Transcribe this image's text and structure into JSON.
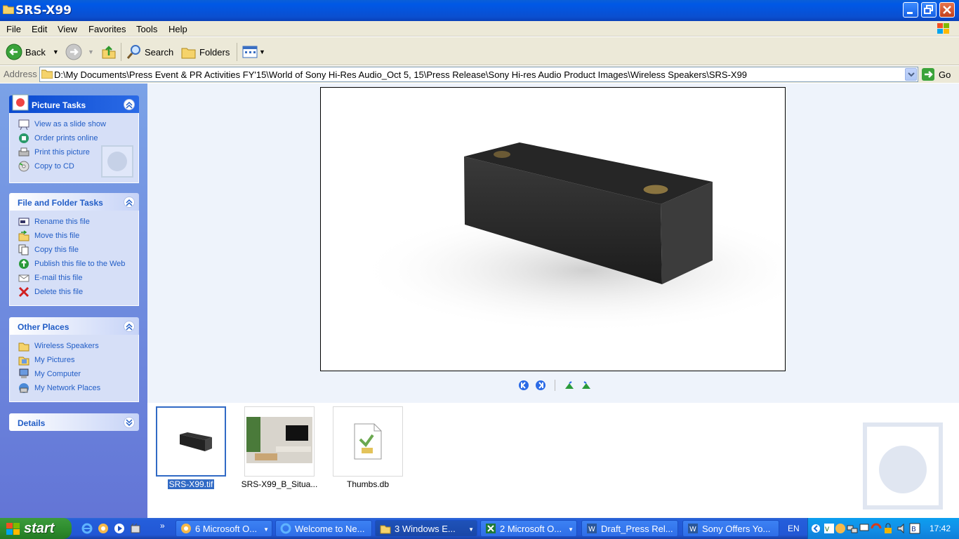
{
  "window": {
    "title": "SRS-X99",
    "controls": [
      "minimize",
      "restore",
      "close"
    ]
  },
  "menu": [
    "File",
    "Edit",
    "View",
    "Favorites",
    "Tools",
    "Help"
  ],
  "toolbar": {
    "back_label": "Back",
    "search_label": "Search",
    "folders_label": "Folders"
  },
  "address": {
    "label": "Address",
    "path": "D:\\My Documents\\Press Event & PR Activities FY'15\\World of Sony Hi-Res Audio_Oct 5, 15\\Press Release\\Sony Hi-res Audio Product Images\\Wireless Speakers\\SRS-X99",
    "go_label": "Go"
  },
  "sidebar": {
    "picture_tasks": {
      "title": "Picture Tasks",
      "items": [
        "View as a slide show",
        "Order prints online",
        "Print this picture",
        "Copy to CD"
      ]
    },
    "file_folder_tasks": {
      "title": "File and Folder Tasks",
      "items": [
        "Rename this file",
        "Move this file",
        "Copy this file",
        "Publish this file to the Web",
        "E-mail this file",
        "Delete this file"
      ]
    },
    "other_places": {
      "title": "Other Places",
      "items": [
        "Wireless Speakers",
        "My Pictures",
        "My Computer",
        "My Network Places"
      ]
    },
    "details": {
      "title": "Details"
    }
  },
  "files": [
    {
      "name": "SRS-X99.tif",
      "selected": true
    },
    {
      "name": "SRS-X99_B_Situa...",
      "selected": false
    },
    {
      "name": "Thumbs.db",
      "selected": false
    }
  ],
  "taskbar": {
    "start_label": "start",
    "tasks": [
      {
        "label": "6 Microsoft O...",
        "active": false
      },
      {
        "label": "Welcome to Ne...",
        "active": false
      },
      {
        "label": "3 Windows E...",
        "active": true
      },
      {
        "label": "2 Microsoft O...",
        "active": false
      },
      {
        "label": "Draft_Press Rel...",
        "active": false
      },
      {
        "label": "Sony Offers Yo...",
        "active": false
      }
    ],
    "language": "EN",
    "clock": "17:42"
  }
}
